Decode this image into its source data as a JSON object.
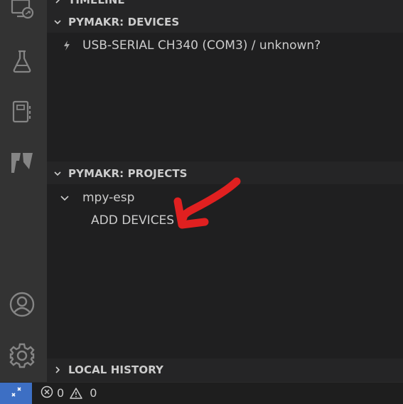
{
  "activity_bar": {
    "icons": [
      "remote-explorer-icon",
      "testing-flask-icon",
      "notebook-icon",
      "pymakr-icon",
      "account-icon",
      "settings-gear-icon"
    ]
  },
  "sections": {
    "timeline": {
      "label": "TIMELINE",
      "expanded": false
    },
    "devices": {
      "label": "PYMAKR: DEVICES",
      "expanded": true,
      "items": [
        {
          "icon": "lightning-icon",
          "label": "USB-SERIAL CH340 (COM3) / unknown?"
        }
      ]
    },
    "projects": {
      "label": "PYMAKR: PROJECTS",
      "expanded": true,
      "project": {
        "label": "mpy-esp",
        "expanded": true
      },
      "child": {
        "label": "ADD DEVICES"
      }
    },
    "local_history": {
      "label": "LOCAL HISTORY",
      "expanded": false
    }
  },
  "status_bar": {
    "errors": "0",
    "warnings": "0"
  },
  "annotation": {
    "color": "#e02020",
    "points_to": "ADD DEVICES"
  }
}
